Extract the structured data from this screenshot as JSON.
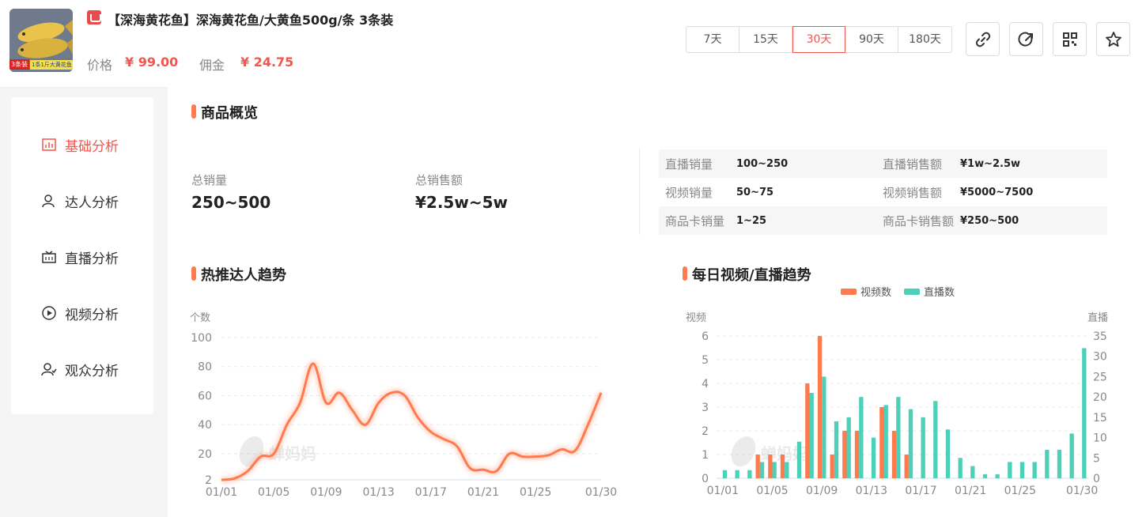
{
  "product": {
    "thumb_badge_left": "3条装",
    "thumb_badge_right": "1条1斤大黄花鱼",
    "title": "【深海黄花鱼】深海黄花鱼/大黄鱼500g/条 3条装",
    "price_label": "价格",
    "price_value": "¥ 99.00",
    "commission_label": "佣金",
    "commission_value": "¥ 24.75"
  },
  "ranges": [
    {
      "label": "7天",
      "active": false
    },
    {
      "label": "15天",
      "active": false
    },
    {
      "label": "30天",
      "active": true
    },
    {
      "label": "90天",
      "active": false
    },
    {
      "label": "180天",
      "active": false
    }
  ],
  "tools": [
    "link-icon",
    "share-icon",
    "qrcode-icon",
    "star-icon"
  ],
  "sidebar": {
    "items": [
      {
        "label": "基础分析",
        "icon": "bar-chart-icon",
        "active": true
      },
      {
        "label": "达人分析",
        "icon": "user-icon",
        "active": false
      },
      {
        "label": "直播分析",
        "icon": "live-icon",
        "active": false
      },
      {
        "label": "视频分析",
        "icon": "play-icon",
        "active": false
      },
      {
        "label": "观众分析",
        "icon": "audience-icon",
        "active": false
      }
    ]
  },
  "overview": {
    "title": "商品概览",
    "total_sales_label": "总销量",
    "total_sales_value": "250~500",
    "total_amount_label": "总销售额",
    "total_amount_value": "¥2.5w~5w",
    "rows": [
      {
        "k1": "直播销量",
        "v1": "100~250",
        "k2": "直播销售额",
        "v2": "¥1w~2.5w"
      },
      {
        "k1": "视频销量",
        "v1": "50~75",
        "k2": "视频销售额",
        "v2": "¥5000~7500"
      },
      {
        "k1": "商品卡销量",
        "v1": "1~25",
        "k2": "商品卡销售额",
        "v2": "¥250~500"
      }
    ]
  },
  "watermark": "蝉妈妈",
  "colors": {
    "accent": "#f2564c",
    "video": "#ff7a4d",
    "live": "#4dd0b8"
  },
  "chart_data": [
    {
      "type": "line",
      "title": "热推达人趋势",
      "ylabel": "个数",
      "ylim": [
        2,
        100
      ],
      "yticks": [
        100,
        80,
        60,
        40,
        20,
        2
      ],
      "xticks": [
        "01/01",
        "01/05",
        "01/09",
        "01/13",
        "01/17",
        "01/21",
        "01/25",
        "01/30"
      ],
      "x": [
        "01/01",
        "01/02",
        "01/03",
        "01/04",
        "01/05",
        "01/06",
        "01/07",
        "01/08",
        "01/09",
        "01/10",
        "01/11",
        "01/12",
        "01/13",
        "01/14",
        "01/15",
        "01/16",
        "01/17",
        "01/18",
        "01/19",
        "01/20",
        "01/21",
        "01/22",
        "01/23",
        "01/24",
        "01/25",
        "01/26",
        "01/27",
        "01/28",
        "01/29",
        "01/30"
      ],
      "values": [
        2,
        3,
        8,
        18,
        20,
        40,
        55,
        82,
        55,
        62,
        50,
        40,
        55,
        62,
        60,
        45,
        35,
        30,
        25,
        10,
        9,
        8,
        20,
        18,
        18,
        19,
        23,
        22,
        40,
        62
      ],
      "grid": true
    },
    {
      "type": "bar",
      "title": "每日视频/直播趋势",
      "ylabel": "视频",
      "y2label": "直播",
      "ylim": [
        0,
        6
      ],
      "y2lim": [
        0,
        35
      ],
      "yticks": [
        6,
        5,
        4,
        3,
        2,
        1,
        0
      ],
      "y2ticks": [
        35,
        30,
        25,
        20,
        15,
        10,
        5,
        0
      ],
      "xticks": [
        "01/01",
        "01/05",
        "01/09",
        "01/13",
        "01/17",
        "01/21",
        "01/25",
        "01/30"
      ],
      "legend_position": "top",
      "series": [
        {
          "name": "视频数",
          "axis": "left",
          "color": "#ff7a4d",
          "values": [
            0,
            0,
            0,
            1,
            1,
            1,
            0,
            4,
            6,
            1,
            2,
            2,
            0,
            3,
            2,
            1,
            0,
            0,
            0,
            0,
            0,
            0,
            0,
            0,
            0,
            0,
            0,
            0,
            0,
            0
          ]
        },
        {
          "name": "直播数",
          "axis": "right",
          "color": "#4dd0b8",
          "values": [
            2,
            2,
            2,
            4,
            4,
            4,
            9,
            21,
            25,
            14,
            15,
            20,
            10,
            18,
            20,
            17,
            15,
            19,
            12,
            5,
            3,
            1,
            1,
            4,
            4,
            4,
            7,
            7,
            11,
            32
          ]
        }
      ],
      "grid": true
    }
  ]
}
